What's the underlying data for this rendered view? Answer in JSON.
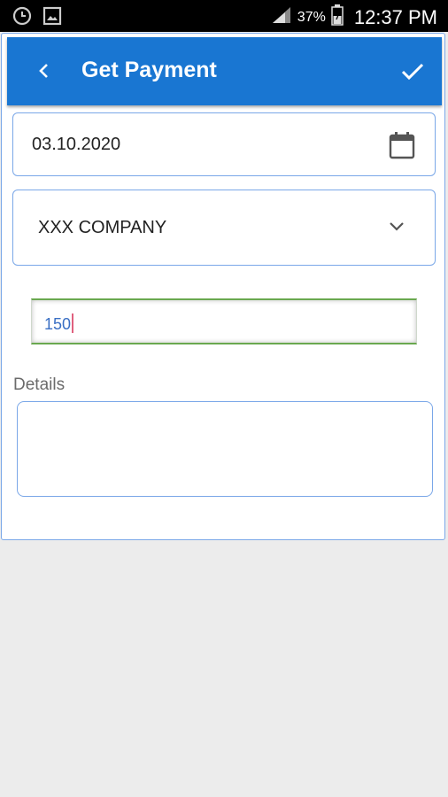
{
  "status_bar": {
    "battery_percent": "37%",
    "time": "12:37 PM",
    "icons": [
      "clock-icon",
      "image-icon",
      "signal-icon",
      "battery-icon"
    ]
  },
  "toolbar": {
    "title": "Get Payment",
    "back_icon": "chevron-left-icon",
    "confirm_icon": "check-icon",
    "color": "#1976d2"
  },
  "form": {
    "date": "03.10.2020",
    "date_icon": "calendar-icon",
    "company": "XXX COMPANY",
    "company_icon": "chevron-down-icon",
    "amount": "150",
    "details_label": "Details",
    "details": ""
  },
  "colors": {
    "field_border": "#7aa7e8",
    "amount_border": "#6aa84f",
    "background": "#ececec"
  }
}
